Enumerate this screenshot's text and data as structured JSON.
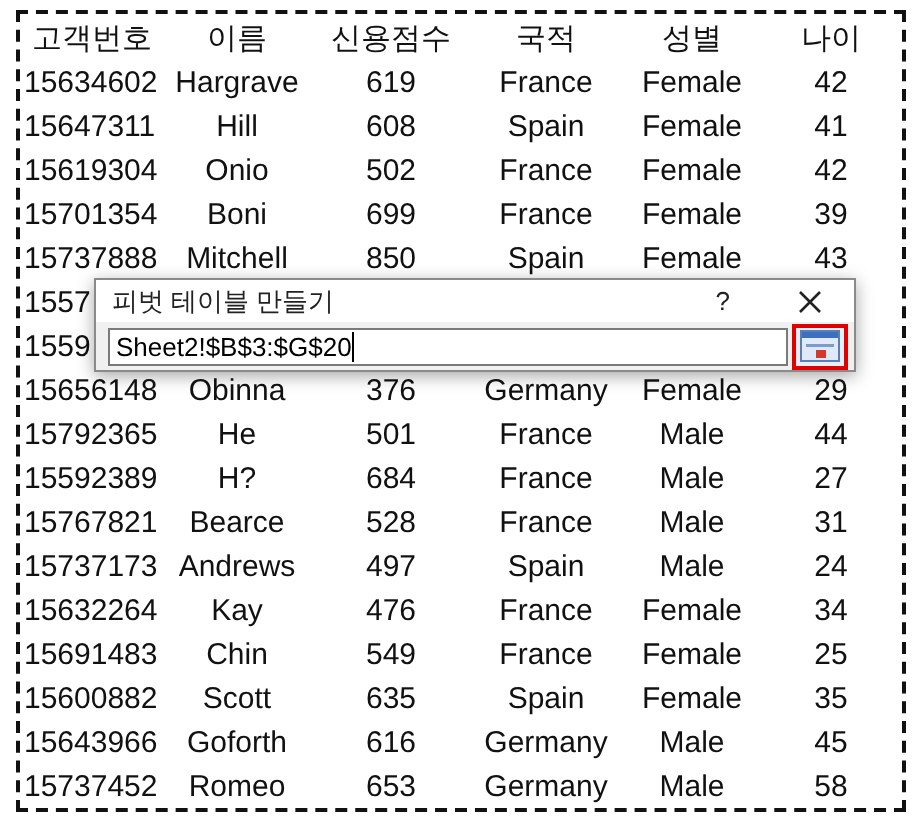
{
  "table": {
    "columns": [
      "고객번호",
      "이름",
      "신용점수",
      "국적",
      "성별",
      "나이"
    ],
    "rows": [
      {
        "cells": [
          "15634602",
          "Hargrave",
          "619",
          "France",
          "Female",
          "42"
        ]
      },
      {
        "cells": [
          "15647311",
          "Hill",
          "608",
          "Spain",
          "Female",
          "41"
        ]
      },
      {
        "cells": [
          "15619304",
          "Onio",
          "502",
          "France",
          "Female",
          "42"
        ]
      },
      {
        "cells": [
          "15701354",
          "Boni",
          "699",
          "France",
          "Female",
          "39"
        ]
      },
      {
        "cells": [
          "15737888",
          "Mitchell",
          "850",
          "Spain",
          "Female",
          "43"
        ]
      },
      {
        "cells": [
          "1557"
        ]
      },
      {
        "cells": [
          "1559"
        ]
      },
      {
        "cells": [
          "15656148",
          "Obinna",
          "376",
          "Germany",
          "Female",
          "29"
        ]
      },
      {
        "cells": [
          "15792365",
          "He",
          "501",
          "France",
          "Male",
          "44"
        ]
      },
      {
        "cells": [
          "15592389",
          "H?",
          "684",
          "France",
          "Male",
          "27"
        ]
      },
      {
        "cells": [
          "15767821",
          "Bearce",
          "528",
          "France",
          "Male",
          "31"
        ]
      },
      {
        "cells": [
          "15737173",
          "Andrews",
          "497",
          "Spain",
          "Male",
          "24"
        ]
      },
      {
        "cells": [
          "15632264",
          "Kay",
          "476",
          "France",
          "Female",
          "34"
        ]
      },
      {
        "cells": [
          "15691483",
          "Chin",
          "549",
          "France",
          "Female",
          "25"
        ]
      },
      {
        "cells": [
          "15600882",
          "Scott",
          "635",
          "Spain",
          "Female",
          "35"
        ]
      },
      {
        "cells": [
          "15643966",
          "Goforth",
          "616",
          "Germany",
          "Male",
          "45"
        ]
      },
      {
        "cells": [
          "15737452",
          "Romeo",
          "653",
          "Germany",
          "Male",
          "58"
        ]
      }
    ]
  },
  "dialog": {
    "title": "피벗 테이블 만들기",
    "help": "?",
    "range": "Sheet2!$B$3:$G$20"
  }
}
